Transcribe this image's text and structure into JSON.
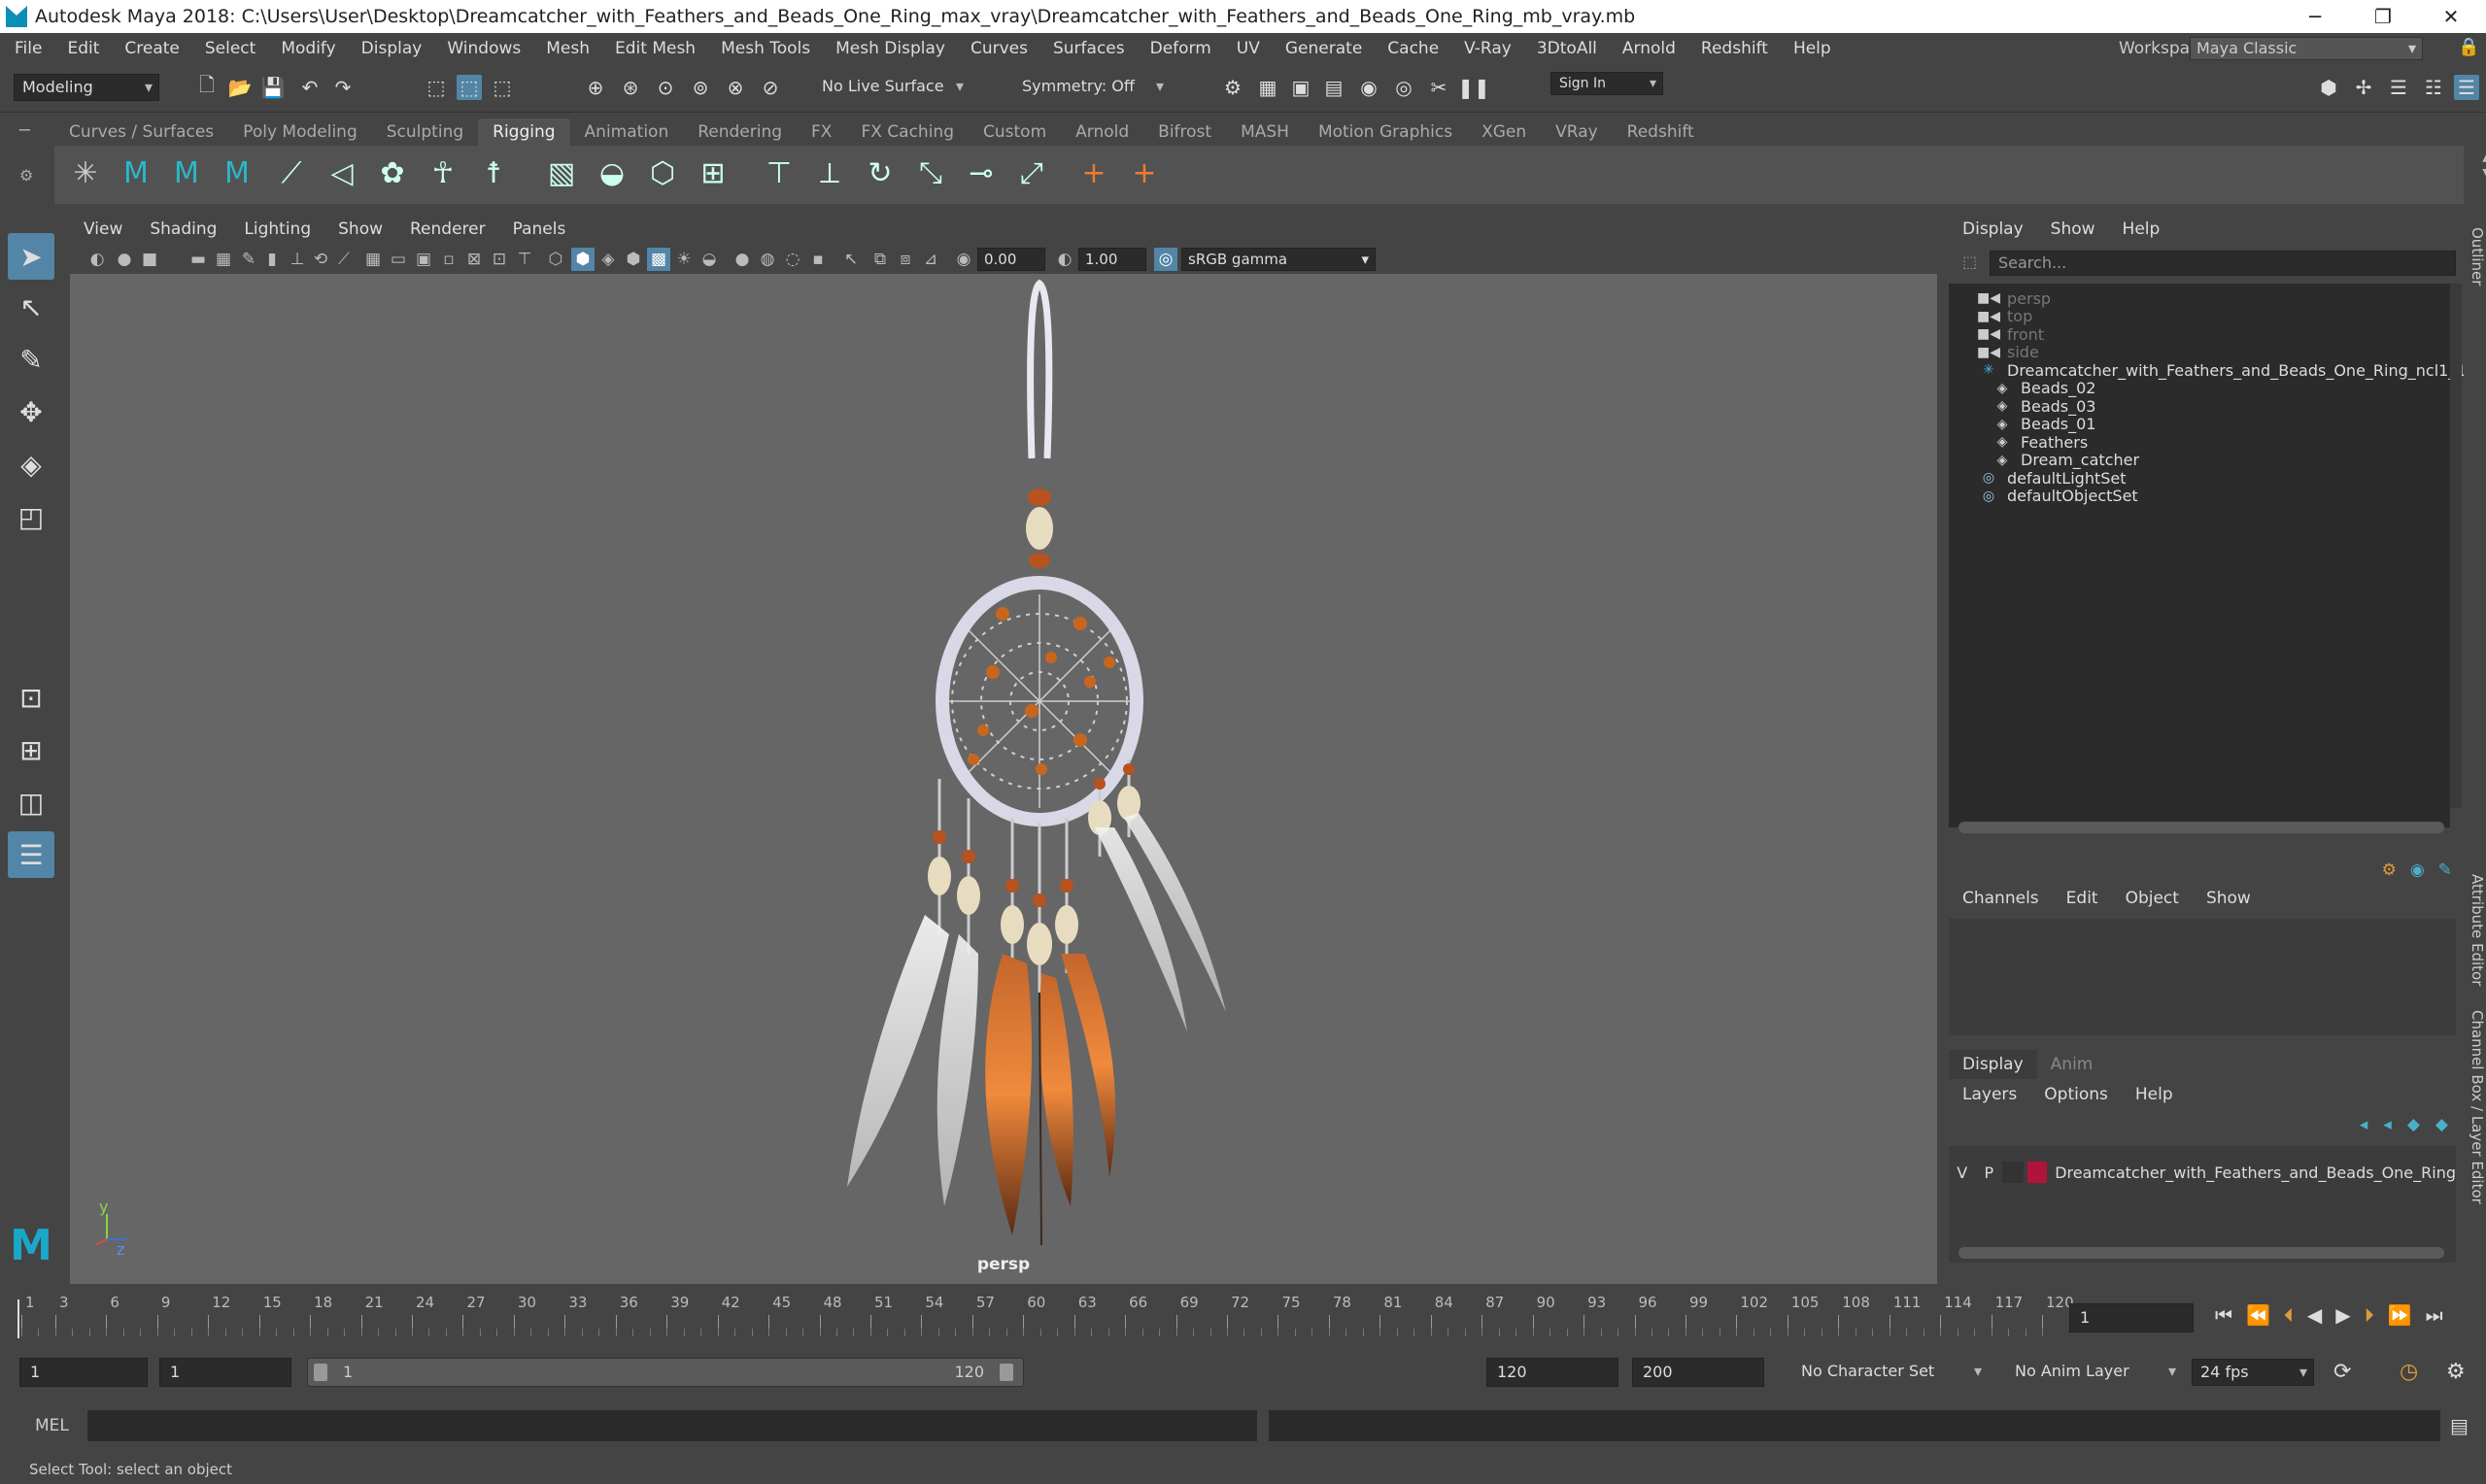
{
  "window": {
    "title": "Autodesk Maya 2018: C:\\Users\\User\\Desktop\\Dreamcatcher_with_Feathers_and_Beads_One_Ring_max_vray\\Dreamcatcher_with_Feathers_and_Beads_One_Ring_mb_vray.mb",
    "minimize": "─",
    "maximize": "❐",
    "close": "✕"
  },
  "menubar": {
    "items": [
      "File",
      "Edit",
      "Create",
      "Select",
      "Modify",
      "Display",
      "Windows",
      "Mesh",
      "Edit Mesh",
      "Mesh Tools",
      "Mesh Display",
      "Curves",
      "Surfaces",
      "Deform",
      "UV",
      "Generate",
      "Cache",
      "V-Ray",
      "3DtoAll",
      "Arnold",
      "Redshift",
      "Help"
    ],
    "workspace_label": "Workspace :",
    "workspace_value": "Maya Classic"
  },
  "statusline": {
    "mode": "Modeling",
    "live_surface": "No Live Surface",
    "symmetry": "Symmetry: Off",
    "sign_in": "Sign In"
  },
  "shelf": {
    "tabs": [
      "Curves / Surfaces",
      "Poly Modeling",
      "Sculpting",
      "Rigging",
      "Animation",
      "Rendering",
      "FX",
      "FX Caching",
      "Custom",
      "Arnold",
      "Bifrost",
      "MASH",
      "Motion Graphics",
      "XGen",
      "VRay",
      "Redshift"
    ],
    "active": "Rigging"
  },
  "viewport": {
    "menu": [
      "View",
      "Shading",
      "Lighting",
      "Show",
      "Renderer",
      "Panels"
    ],
    "exposure": "0.00",
    "gamma": "1.00",
    "colorspace": "sRGB gamma",
    "camera_label": "persp",
    "axis_y": "y",
    "axis_z": "z"
  },
  "outliner": {
    "menu": [
      "Display",
      "Show",
      "Help"
    ],
    "search_placeholder": "Search...",
    "items": [
      {
        "label": "persp",
        "icon": "camera-icon",
        "dim": true,
        "indent": 1
      },
      {
        "label": "top",
        "icon": "camera-icon",
        "dim": true,
        "indent": 1
      },
      {
        "label": "front",
        "icon": "camera-icon",
        "dim": true,
        "indent": 1
      },
      {
        "label": "side",
        "icon": "camera-icon",
        "dim": true,
        "indent": 1
      },
      {
        "label": "Dreamcatcher_with_Feathers_and_Beads_One_Ring_ncl1_1",
        "icon": "group-icon",
        "dim": false,
        "indent": 1
      },
      {
        "label": "Beads_02",
        "icon": "mesh-icon",
        "dim": false,
        "indent": 2
      },
      {
        "label": "Beads_03",
        "icon": "mesh-icon",
        "dim": false,
        "indent": 2
      },
      {
        "label": "Beads_01",
        "icon": "mesh-icon",
        "dim": false,
        "indent": 2
      },
      {
        "label": "Feathers",
        "icon": "mesh-icon",
        "dim": false,
        "indent": 2
      },
      {
        "label": "Dream_catcher",
        "icon": "mesh-icon",
        "dim": false,
        "indent": 2
      },
      {
        "label": "defaultLightSet",
        "icon": "set-icon",
        "dim": false,
        "indent": 1
      },
      {
        "label": "defaultObjectSet",
        "icon": "set-icon",
        "dim": false,
        "indent": 1
      }
    ]
  },
  "channelbox": {
    "menu": [
      "Channels",
      "Edit",
      "Object",
      "Show"
    ]
  },
  "layereditor": {
    "tabs": [
      "Display",
      "Anim"
    ],
    "menu": [
      "Layers",
      "Options",
      "Help"
    ],
    "layer": {
      "v": "V",
      "p": "P",
      "name": "Dreamcatcher_with_Feathers_and_Beads_One_Ring",
      "color": "#b0143a"
    }
  },
  "sidetabs": [
    "Outliner",
    "Attribute Editor",
    "Channel Box / Layer Editor"
  ],
  "timeline": {
    "ticks": [
      "1",
      "3",
      "6",
      "9",
      "12",
      "15",
      "18",
      "21",
      "24",
      "27",
      "30",
      "33",
      "36",
      "39",
      "42",
      "45",
      "48",
      "51",
      "54",
      "57",
      "60",
      "63",
      "66",
      "69",
      "72",
      "75",
      "78",
      "81",
      "84",
      "87",
      "90",
      "93",
      "96",
      "99",
      "102",
      "105",
      "108",
      "111",
      "114",
      "117",
      "120"
    ],
    "current_frame": "1"
  },
  "range": {
    "start": "1",
    "playback_start": "1",
    "slider_start": "1",
    "slider_end": "120",
    "playback_end": "120",
    "end": "200",
    "character_set": "No Character Set",
    "anim_layer": "No Anim Layer",
    "fps": "24 fps"
  },
  "command": {
    "language": "MEL"
  },
  "help": {
    "text": "Select Tool: select an object"
  },
  "colors": {
    "accent": "#5285a6",
    "panel": "#444444",
    "field": "#2b2b2b",
    "viewport": "#666666"
  }
}
